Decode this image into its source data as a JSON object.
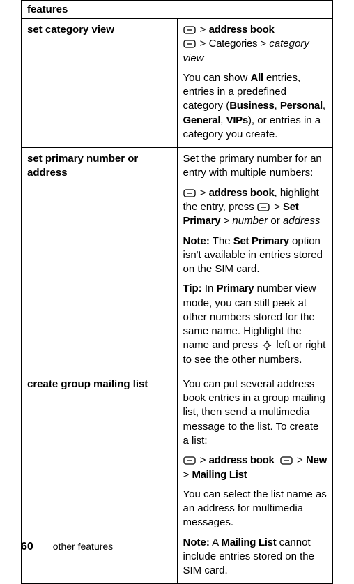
{
  "header": "features",
  "rows": [
    {
      "title": "set category view",
      "line1_pre": "",
      "line1_mid": "address book",
      "line1_post": "",
      "line2_label": "Categories",
      "line2_val": "category view",
      "p1a": "You can show ",
      "p1_all": "All",
      "p1b": " entries, entries in a predefined category (",
      "p1_biz": "Business",
      "p1_sep1": ", ",
      "p1_pers": "Personal",
      "p1_sep2": ", ",
      "p1_gen": "General",
      "p1_sep3": ", ",
      "p1_vip": "VIPs",
      "p1c": "), or entries in a category you create."
    },
    {
      "title": "set primary number or address",
      "intro": "Set the primary number for an entry with multiple numbers:",
      "step_ab": "address book",
      "step_hl": ", highlight the entry, press ",
      "step_sp": "Set Primary",
      "step_num": "number",
      "step_or": " or ",
      "step_addr": "address",
      "note_label": "Note:",
      "note_a": " The ",
      "note_sp": "Set Primary",
      "note_b": " option isn't available in entries stored on the SIM card.",
      "tip_label": "Tip:",
      "tip_a": " In ",
      "tip_primary": "Primary",
      "tip_b": " number view mode, you can still peek at other numbers stored for the same name. Highlight the name and press ",
      "tip_c": " left or right to see the other numbers."
    },
    {
      "title": "create group mailing list",
      "intro": "You can put several address book entries in a group mailing list, then send a multimedia message to the list. To create a list:",
      "step_ab": "address book",
      "step_new": "New",
      "step_ml": "Mailing List",
      "p2": "You can select the list name as an address for multimedia messages.",
      "note_label": "Note:",
      "note_a": " A ",
      "note_ml": "Mailing List",
      "note_b": " cannot include entries stored on the SIM card."
    }
  ],
  "gt": " > ",
  "footer": {
    "page": "60",
    "section": "other features"
  }
}
